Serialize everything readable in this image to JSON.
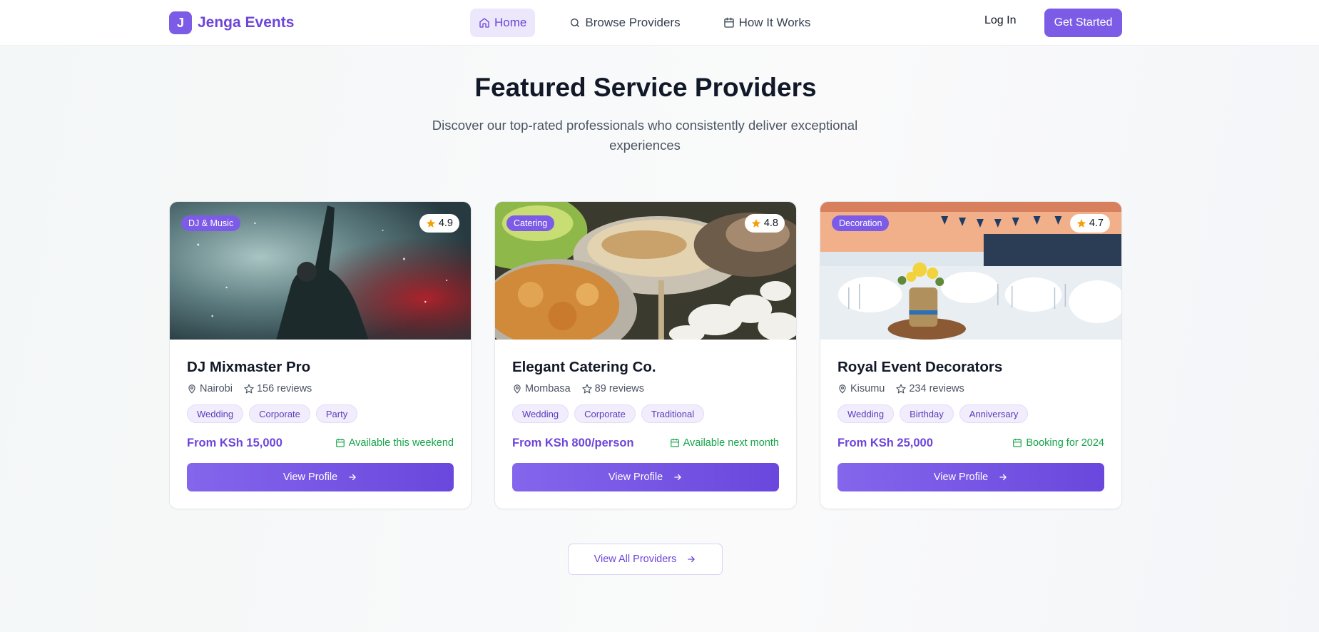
{
  "nav": {
    "brand_mark": "J",
    "brand_name": "Jenga Events",
    "links": [
      {
        "label": "Home",
        "icon": "home-icon",
        "active": true
      },
      {
        "label": "Browse Providers",
        "icon": "search-icon"
      },
      {
        "label": "How It Works",
        "icon": "calendar-icon"
      }
    ],
    "login": "Log In",
    "cta": "Get Started"
  },
  "hero": {
    "title": "Featured Service Providers",
    "subtitle": "Discover our top-rated professionals who consistently deliver exceptional experiences"
  },
  "providers": [
    {
      "category": "DJ & Music",
      "rating": "4.9",
      "name": "DJ Mixmaster Pro",
      "location": "Nairobi",
      "reviews": "156 reviews",
      "tags": [
        "Wedding",
        "Corporate",
        "Party"
      ],
      "price": "From KSh 15,000",
      "availability": "Available this weekend",
      "button": "View Profile"
    },
    {
      "category": "Catering",
      "rating": "4.8",
      "name": "Elegant Catering Co.",
      "location": "Mombasa",
      "reviews": "89 reviews",
      "tags": [
        "Wedding",
        "Corporate",
        "Traditional"
      ],
      "price": "From KSh 800/person",
      "availability": "Available next month",
      "button": "View Profile"
    },
    {
      "category": "Decoration",
      "rating": "4.7",
      "name": "Royal Event Decorators",
      "location": "Kisumu",
      "reviews": "234 reviews",
      "tags": [
        "Wedding",
        "Birthday",
        "Anniversary"
      ],
      "price": "From KSh 25,000",
      "availability": "Booking for 2024",
      "button": "View Profile"
    }
  ],
  "view_all": "View All Providers",
  "colors": {
    "accent": "#7c5ce6",
    "accent_dark": "#6d45d9",
    "success": "#16a34a",
    "star": "#f59e0b"
  }
}
